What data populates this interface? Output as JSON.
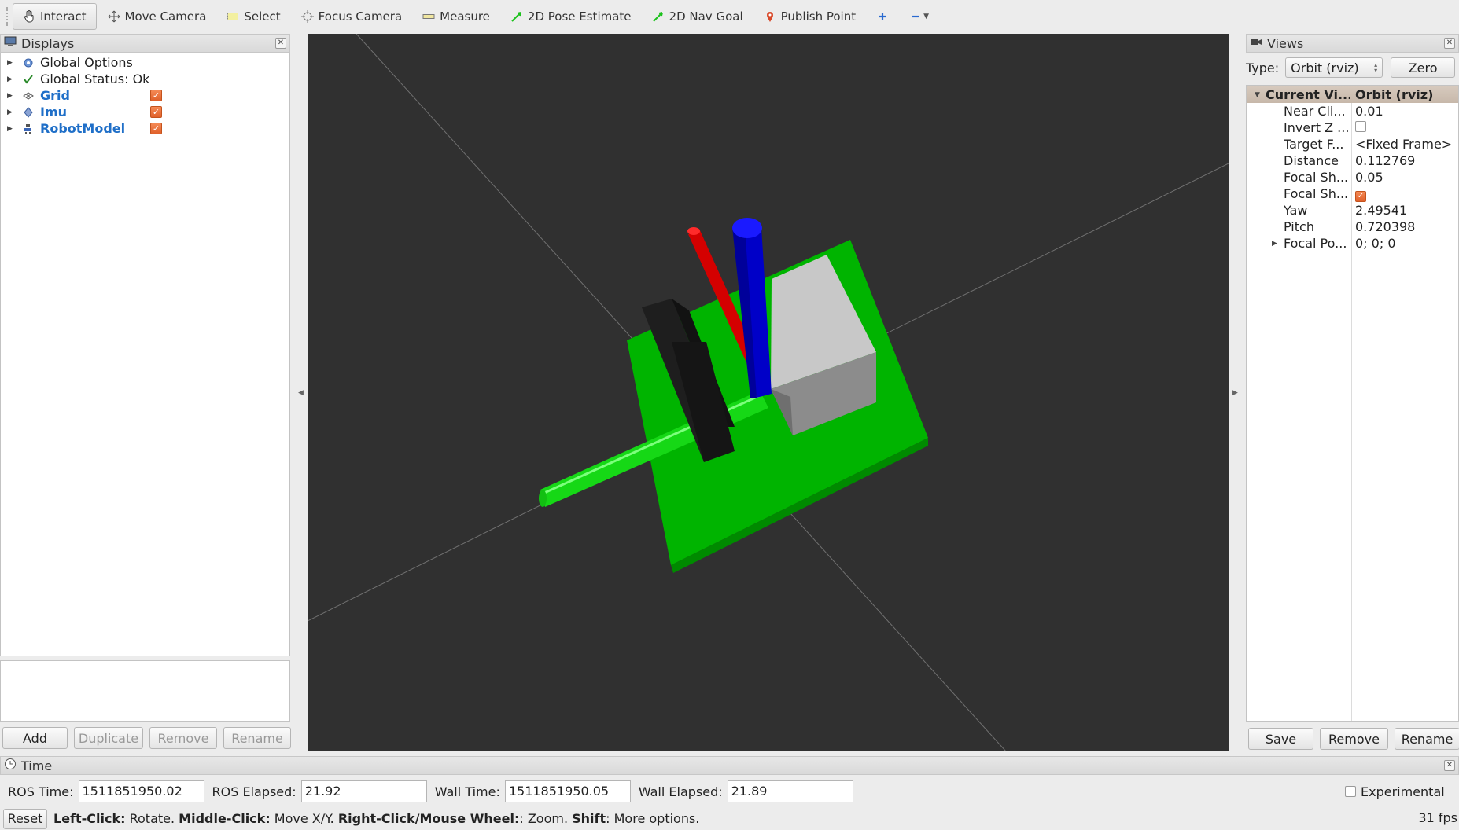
{
  "toolbar": {
    "tools": [
      {
        "label": "Interact",
        "icon": "hand-cursor-icon"
      },
      {
        "label": "Move Camera",
        "icon": "move-camera-icon"
      },
      {
        "label": "Select",
        "icon": "select-rect-icon"
      },
      {
        "label": "Focus Camera",
        "icon": "focus-target-icon"
      },
      {
        "label": "Measure",
        "icon": "ruler-icon"
      },
      {
        "label": "2D Pose Estimate",
        "icon": "green-arrow-icon"
      },
      {
        "label": "2D Nav Goal",
        "icon": "green-arrow-icon"
      },
      {
        "label": "Publish Point",
        "icon": "map-pin-icon"
      }
    ]
  },
  "displays": {
    "title": "Displays",
    "items": [
      {
        "label": "Global Options",
        "icon": "gear-icon",
        "checked": null
      },
      {
        "label": "Global Status: Ok",
        "icon": "checkmark-icon",
        "checked": null
      },
      {
        "label": "Grid",
        "icon": "grid-icon",
        "checked": true
      },
      {
        "label": "Imu",
        "icon": "imu-icon",
        "checked": true
      },
      {
        "label": "RobotModel",
        "icon": "robot-model-icon",
        "checked": true
      }
    ],
    "buttons": {
      "add": "Add",
      "duplicate": "Duplicate",
      "remove": "Remove",
      "rename": "Rename"
    }
  },
  "views": {
    "title": "Views",
    "type_label": "Type:",
    "type_value": "Orbit (rviz)",
    "zero_button": "Zero",
    "header": {
      "key": "Current Vi...",
      "value": "Orbit (rviz)"
    },
    "props": [
      {
        "key": "Near Cli...",
        "value": "0.01"
      },
      {
        "key": "Invert Z ...",
        "value": "",
        "checkbox": false
      },
      {
        "key": "Target F...",
        "value": "<Fixed Frame>"
      },
      {
        "key": "Distance",
        "value": "0.112769"
      },
      {
        "key": "Focal Sh...",
        "value": "0.05"
      },
      {
        "key": "Focal Sh...",
        "value": "",
        "checkbox": true
      },
      {
        "key": "Yaw",
        "value": "2.49541"
      },
      {
        "key": "Pitch",
        "value": "0.720398"
      },
      {
        "key": "Focal Po...",
        "value": "0; 0; 0"
      }
    ],
    "buttons": {
      "save": "Save",
      "remove": "Remove",
      "rename": "Rename"
    }
  },
  "time": {
    "title": "Time",
    "ros_time_label": "ROS Time:",
    "ros_time": "1511851950.02",
    "ros_elapsed_label": "ROS Elapsed:",
    "ros_elapsed": "21.92",
    "wall_time_label": "Wall Time:",
    "wall_time": "1511851950.05",
    "wall_elapsed_label": "Wall Elapsed:",
    "wall_elapsed": "21.89",
    "experimental_label": "Experimental"
  },
  "status": {
    "reset_button": "Reset",
    "hints": [
      {
        "bold": "Left-Click:",
        "text": " Rotate. "
      },
      {
        "bold": "Middle-Click:",
        "text": " Move X/Y. "
      },
      {
        "bold": "Right-Click/Mouse Wheel:",
        "text": ": Zoom. "
      },
      {
        "bold": "Shift",
        "text": ": More options."
      }
    ],
    "fps": "31 fps"
  },
  "colors": {
    "viewport_bg": "#303030",
    "base_green": "#00b400",
    "x_axis_red": "#d40000",
    "z_axis_blue": "#0000c8",
    "link_name_blue": "#1f6fc8",
    "checkbox_orange": "#e8682f"
  }
}
